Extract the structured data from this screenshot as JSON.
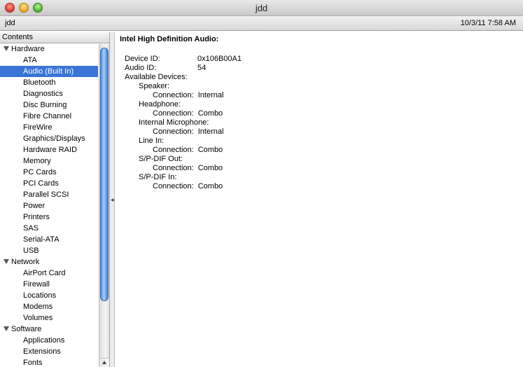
{
  "window": {
    "title": "jdd"
  },
  "toolbar": {
    "host": "jdd",
    "datetime": "10/3/11 7:58 AM"
  },
  "sidebar": {
    "header": "Contents",
    "groups": [
      {
        "label": "Hardware",
        "items": [
          "ATA",
          "Audio (Built In)",
          "Bluetooth",
          "Diagnostics",
          "Disc Burning",
          "Fibre Channel",
          "FireWire",
          "Graphics/Displays",
          "Hardware RAID",
          "Memory",
          "PC Cards",
          "PCI Cards",
          "Parallel SCSI",
          "Power",
          "Printers",
          "SAS",
          "Serial-ATA",
          "USB"
        ]
      },
      {
        "label": "Network",
        "items": [
          "AirPort Card",
          "Firewall",
          "Locations",
          "Modems",
          "Volumes"
        ]
      },
      {
        "label": "Software",
        "items": [
          "Applications",
          "Extensions",
          "Fonts"
        ]
      }
    ],
    "selected": "Audio (Built In)"
  },
  "content": {
    "title": "Intel High Definition Audio:",
    "device_id_label": "Device ID:",
    "device_id": "0x106B00A1",
    "audio_id_label": "Audio ID:",
    "audio_id": "54",
    "available_devices_label": "Available Devices:",
    "connection_label": "Connection:",
    "devices": [
      {
        "name": "Speaker:",
        "connection": "Internal"
      },
      {
        "name": "Headphone:",
        "connection": "Combo"
      },
      {
        "name": "Internal Microphone:",
        "connection": "Internal"
      },
      {
        "name": "Line In:",
        "connection": "Combo"
      },
      {
        "name": "S/P-DIF Out:",
        "connection": "Combo"
      },
      {
        "name": "S/P-DIF In:",
        "connection": "Combo"
      }
    ]
  }
}
